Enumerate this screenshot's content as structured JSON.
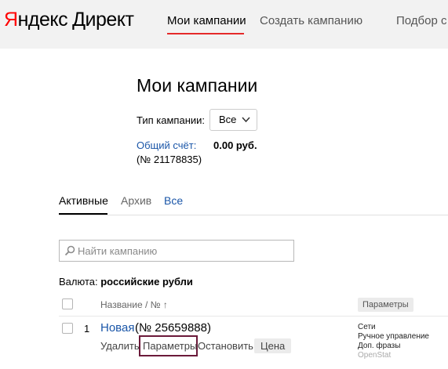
{
  "header": {
    "logo_ya": "Я",
    "logo_rest": "ндекс",
    "logo_direct": "Директ",
    "nav": {
      "my_campaigns": "Мои кампании",
      "create_campaign": "Создать кампанию",
      "podbor": "Подбор с"
    },
    "colors": {
      "accent_red": "#e52a2a",
      "link_blue": "#1a56a8"
    }
  },
  "main": {
    "title": "Мои кампании",
    "type_filter": {
      "label": "Тип кампании:",
      "value": "Все"
    },
    "account": {
      "link": "Общий счёт:",
      "sum": "0.00 руб.",
      "number": "(№ 21178835)"
    },
    "tabs": [
      {
        "label": "Активные",
        "active": true
      },
      {
        "label": "Архив"
      },
      {
        "label": "Все"
      }
    ],
    "search": {
      "placeholder": "Найти кампанию"
    },
    "currency": {
      "label": "Валюта:",
      "value": "российские рубли"
    },
    "table": {
      "header_name": "Название / № ↑",
      "header_params": "Параметры",
      "rows": [
        {
          "index": "1",
          "name": "Новая",
          "number": "(№ 25659888)",
          "actions": {
            "delete": "Удалить",
            "params": "Параметры",
            "stop": "Остановить",
            "price": "Цена"
          },
          "params": [
            "Сети",
            "Ручное управление",
            "Доп. фразы",
            "OpenStat"
          ]
        }
      ]
    }
  }
}
